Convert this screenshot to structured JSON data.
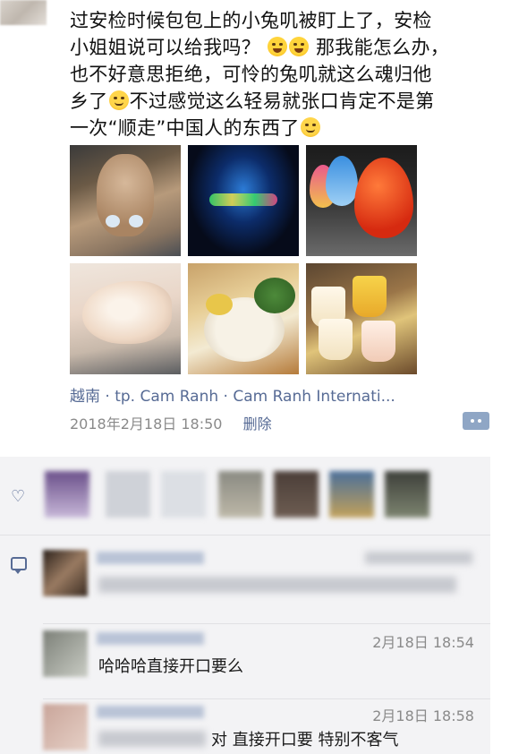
{
  "post": {
    "text_line1": "过安检时候包包上的小兔叽被盯上了，安检",
    "text_line2_a": "小姐姐说可以给我吗？",
    "text_line2_b": "那我能怎么办，",
    "text_line3": "也不好意思拒绝，可怜的兔叽就这么魂归他",
    "text_line4_a": "乡了",
    "text_line4_b": "不过感觉这么轻易就张口肯定不是第",
    "text_line5_a": "一次“顺走”中国人的东西了",
    "location": "越南 · tp. Cam Ranh · Cam Ranh Internati...",
    "time": "2018年2月18日 18:50",
    "delete_label": "删除"
  },
  "comments": [
    {
      "time": "",
      "text": ""
    },
    {
      "time": "2月18日 18:54",
      "text": "哈哈哈直接开口要么"
    },
    {
      "time": "2月18日 18:58",
      "text": "对 直接开口要 特别不客气"
    }
  ],
  "icons": {
    "like": "heart-icon",
    "comment": "comment-icon",
    "more": "more-icon"
  },
  "colors": {
    "link": "#576b95",
    "comment_bg": "#f3f3f5"
  }
}
